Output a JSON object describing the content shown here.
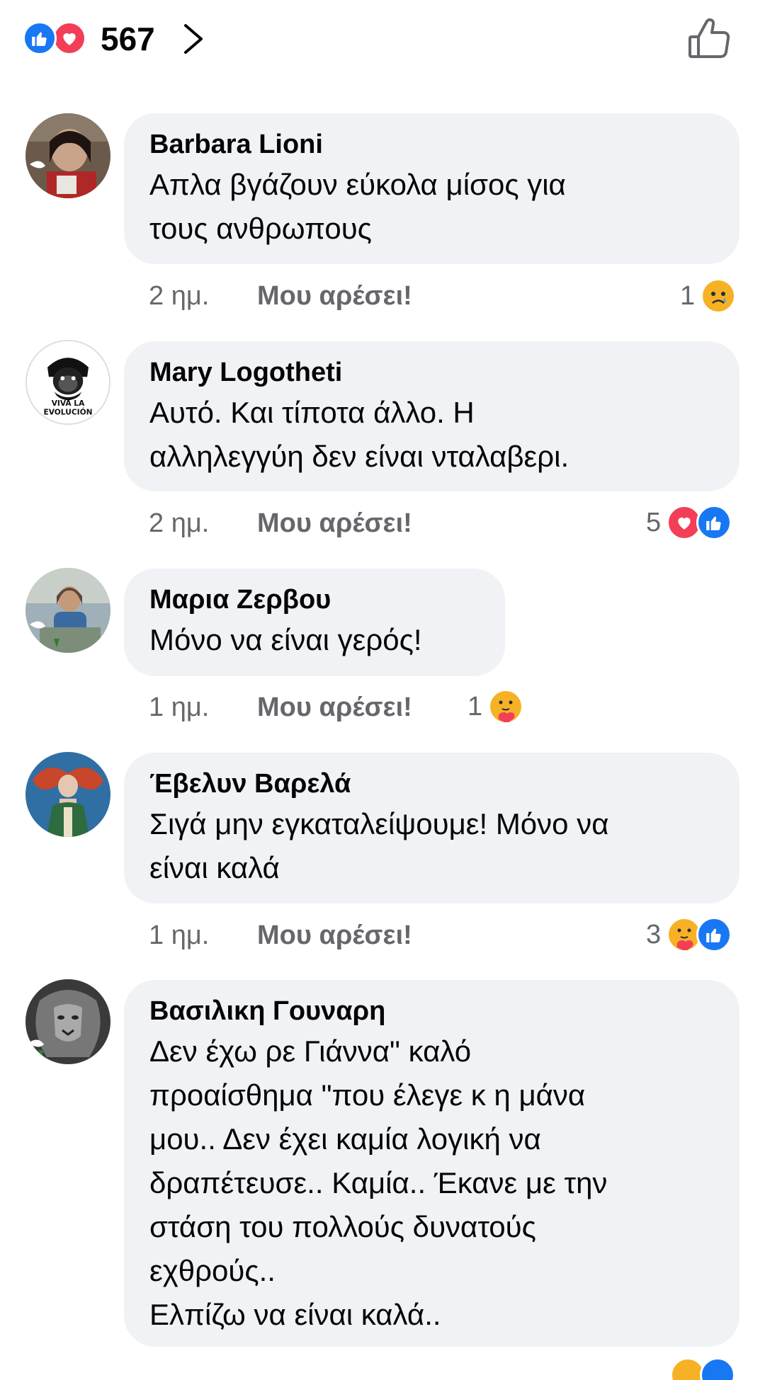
{
  "reactions_bar": {
    "count": "567",
    "icons": [
      "like-icon",
      "love-icon"
    ]
  },
  "comments": [
    {
      "author": "Barbara Lioni",
      "text": "Απλα βγάζουν εύκολα μίσος για\nτους ανθρωπους",
      "time": "2 ημ.",
      "like_label": "Μου αρέσει!",
      "reaction_count": "1",
      "reactions": [
        "sad-icon"
      ]
    },
    {
      "author": "Mary Logotheti",
      "text": "Αυτό. Και τίποτα άλλο. Η\nαλληλεγγύη δεν είναι νταλαβερι.",
      "time": "2 ημ.",
      "like_label": "Μου αρέσει!",
      "reaction_count": "5",
      "reactions": [
        "love-icon",
        "like-icon"
      ],
      "avatar_text": [
        "VIVA LA",
        "EVOLUCIÓN"
      ]
    },
    {
      "author": "Μαρια Ζερβου",
      "text": "Μόνο να είναι γερός!",
      "time": "1 ημ.",
      "like_label": "Μου αρέσει!",
      "reaction_count": "1",
      "reactions": [
        "care-icon"
      ]
    },
    {
      "author": "Έβελυν Βαρελά",
      "text": "Σιγά μην εγκαταλείψουμε! Μόνο να\nείναι καλά",
      "time": "1 ημ.",
      "like_label": "Μου αρέσει!",
      "reaction_count": "3",
      "reactions": [
        "care-icon",
        "like-icon"
      ]
    },
    {
      "author": "Βασιλικη Γουναρη",
      "text": "Δεν έχω ρε Γιάννα\" καλό\nπροαίσθημα \"που έλεγε κ η μάνα\nμου.. Δεν έχει καμία λογική να\nδραπέτευσε.. Καμία.. Έκανε με την\nστάση του πολλούς δυνατούς\nεχθρούς..\nΕλπίζω να είναι καλά..",
      "reactions": [
        "care-icon",
        "like-icon"
      ]
    }
  ],
  "colors": {
    "like_blue": "#1877f2",
    "love_red": "#f33e58",
    "care_yellow": "#f7b125",
    "bubble_bg": "#f0f2f5",
    "meta_gray": "#65676b"
  }
}
